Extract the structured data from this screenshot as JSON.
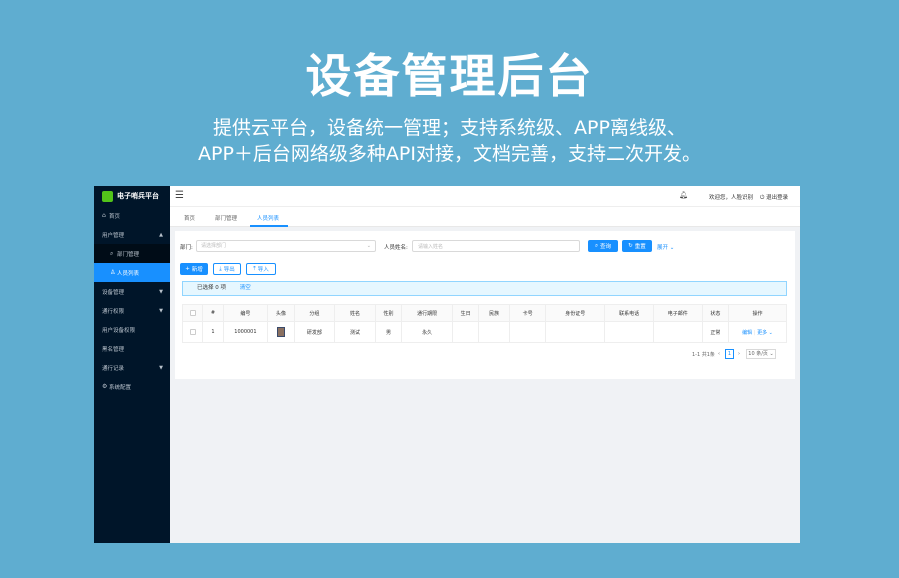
{
  "hero": {
    "title": "设备管理后台",
    "line1": "提供云平台，设备统一管理；支持系统级、APP离线级、",
    "line2": "APP＋后台网络级多种API对接，文档完善，支持二次开发。"
  },
  "sidebar": {
    "app_name": "电子哨兵平台",
    "items": [
      {
        "label": "首页",
        "icon": "home-icon"
      },
      {
        "label": "用户管理",
        "icon": ""
      },
      {
        "label": "部门管理",
        "icon": "search-icon"
      },
      {
        "label": "人员列表",
        "icon": "user-icon"
      },
      {
        "label": "设备管理",
        "icon": ""
      },
      {
        "label": "通行权限",
        "icon": ""
      },
      {
        "label": "用户设备权限",
        "icon": ""
      },
      {
        "label": "黑名管理",
        "icon": ""
      },
      {
        "label": "通行记录",
        "icon": ""
      },
      {
        "label": "系统配置",
        "icon": "gear-icon"
      }
    ]
  },
  "topbar": {
    "welcome": "欢迎您，人脸识别",
    "logout": "退出登录"
  },
  "tabs": [
    "首页",
    "部门管理",
    "人员列表"
  ],
  "search": {
    "dept_label": "部门:",
    "dept_placeholder": "请选择部门",
    "name_label": "人员姓名:",
    "name_placeholder": "请输入姓名",
    "query_btn": "查询",
    "reset_btn": "重置",
    "collapse": "展开"
  },
  "actions": {
    "add": "新增",
    "export": "导出",
    "import": "导入"
  },
  "alert": {
    "selected": "已选择 0 项",
    "clear": "清空"
  },
  "table": {
    "columns": [
      "#",
      "编号",
      "头像",
      "分组",
      "姓名",
      "性别",
      "通行期限",
      "生日",
      "民族",
      "卡号",
      "身份证号",
      "联系电话",
      "电子邮件",
      "状态",
      "操作"
    ],
    "rows": [
      {
        "index": "1",
        "code": "1000001",
        "group": "研发部",
        "name": "测试",
        "gender": "男",
        "period": "永久",
        "birthday": "",
        "ethnic": "",
        "card": "",
        "idcard": "",
        "phone": "",
        "email": "",
        "status": "正常",
        "edit": "编辑",
        "more": "更多"
      }
    ]
  },
  "pager": {
    "total": "1-1 共1条",
    "page": "1",
    "size": "10 条/页"
  },
  "colors": {
    "primary": "#1890ff",
    "sidebar": "#001529",
    "background": "#5fadd0"
  }
}
